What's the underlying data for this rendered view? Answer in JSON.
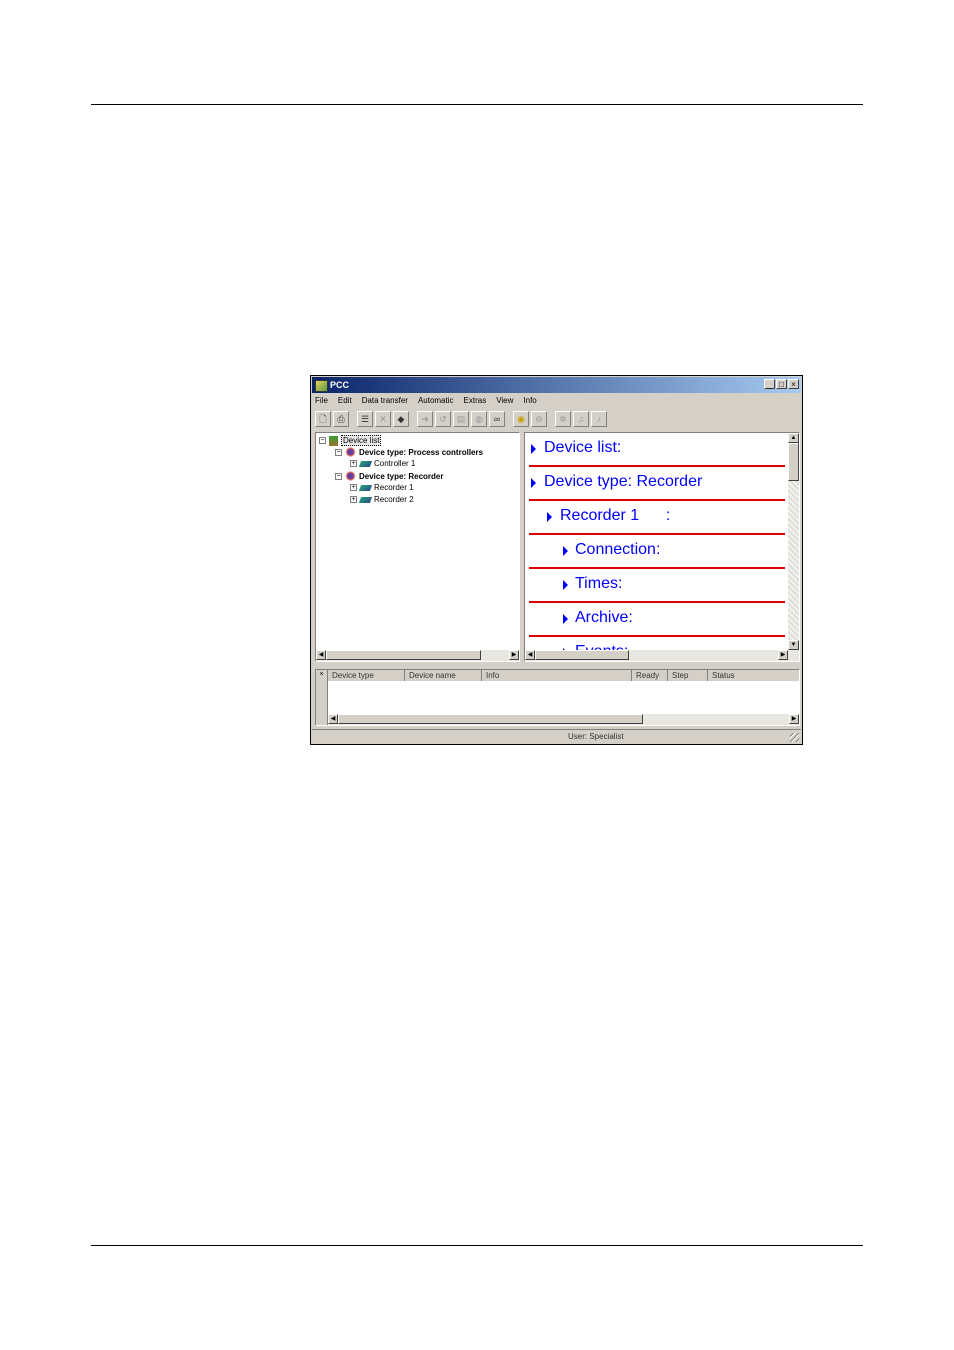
{
  "window": {
    "title": "PCC"
  },
  "menu": [
    "File",
    "Edit",
    "Data transfer",
    "Automatic",
    "Extras",
    "View",
    "Info"
  ],
  "toolbar": [
    {
      "icon": "preview-icon"
    },
    {
      "icon": "print-icon"
    },
    {
      "icon": "properties-icon"
    },
    {
      "icon": "delete-icon"
    },
    {
      "icon": "device-icon"
    },
    {
      "icon": "arrow-right-icon"
    },
    {
      "icon": "arrow-left-icon"
    },
    {
      "icon": "chart-icon"
    },
    {
      "icon": "globe-icon"
    },
    {
      "icon": "binoculars-icon"
    },
    {
      "icon": "clock-icon"
    },
    {
      "icon": "counter-icon"
    },
    {
      "icon": "settings-icon"
    },
    {
      "icon": "bell-icon"
    },
    {
      "icon": "bell-off-icon"
    }
  ],
  "tree": {
    "root": "Device list",
    "groups": [
      {
        "label": "Device type: Process controllers",
        "children": [
          "Controller 1"
        ]
      },
      {
        "label": "Device type: Recorder",
        "children": [
          "Recorder 1",
          "Recorder 2"
        ]
      }
    ]
  },
  "detail": {
    "rows": [
      "Device list:",
      "Device type: Recorder",
      "Recorder 1      :",
      "Connection:",
      "Times:",
      "Archive:",
      "Events:"
    ]
  },
  "list": {
    "columns": [
      "Device type",
      "Device name",
      "Info",
      "Ready",
      "Step",
      "Status"
    ]
  },
  "status": {
    "user": "User: Specialist"
  }
}
